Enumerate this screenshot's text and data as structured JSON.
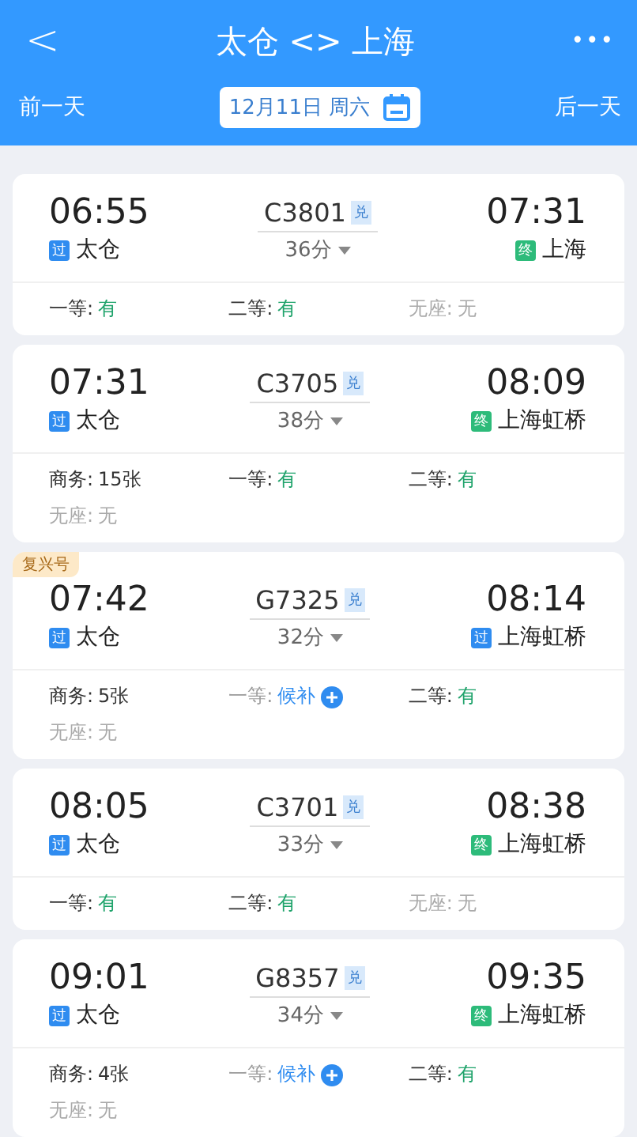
{
  "header": {
    "back": "<",
    "title": "太仓 <> 上海",
    "more": "•••",
    "prev_day": "前一天",
    "date": "12月11日 周六",
    "next_day": "后一天"
  },
  "trains": [
    {
      "depart_time": "06:55",
      "from_tag": {
        "kind": "pass",
        "text": "过"
      },
      "from": "太仓",
      "number": "C3801",
      "exchange": "兑",
      "duration": "36分",
      "arrive_time": "07:31",
      "to_tag": {
        "kind": "end",
        "text": "终"
      },
      "to": "上海",
      "seats": [
        {
          "label": "一等:",
          "value": "有",
          "kind": "avail"
        },
        {
          "label": "二等:",
          "value": "有",
          "kind": "avail"
        },
        {
          "label": "无座:",
          "value": "无",
          "kind": "none"
        }
      ]
    },
    {
      "depart_time": "07:31",
      "from_tag": {
        "kind": "pass",
        "text": "过"
      },
      "from": "太仓",
      "number": "C3705",
      "exchange": "兑",
      "duration": "38分",
      "arrive_time": "08:09",
      "to_tag": {
        "kind": "end",
        "text": "终"
      },
      "to": "上海虹桥",
      "seats": [
        {
          "label": "商务:",
          "value": "15张",
          "kind": "count"
        },
        {
          "label": "一等:",
          "value": "有",
          "kind": "avail"
        },
        {
          "label": "二等:",
          "value": "有",
          "kind": "avail"
        },
        {
          "label": "无座:",
          "value": "无",
          "kind": "none"
        }
      ]
    },
    {
      "badge": "复兴号",
      "depart_time": "07:42",
      "from_tag": {
        "kind": "pass",
        "text": "过"
      },
      "from": "太仓",
      "number": "G7325",
      "exchange": "兑",
      "duration": "32分",
      "arrive_time": "08:14",
      "to_tag": {
        "kind": "pass",
        "text": "过"
      },
      "to": "上海虹桥",
      "seats": [
        {
          "label": "商务:",
          "value": "5张",
          "kind": "count"
        },
        {
          "label": "一等:",
          "value": "候补",
          "kind": "waitlist"
        },
        {
          "label": "二等:",
          "value": "有",
          "kind": "avail"
        },
        {
          "label": "无座:",
          "value": "无",
          "kind": "none"
        }
      ]
    },
    {
      "depart_time": "08:05",
      "from_tag": {
        "kind": "pass",
        "text": "过"
      },
      "from": "太仓",
      "number": "C3701",
      "exchange": "兑",
      "duration": "33分",
      "arrive_time": "08:38",
      "to_tag": {
        "kind": "end",
        "text": "终"
      },
      "to": "上海虹桥",
      "seats": [
        {
          "label": "一等:",
          "value": "有",
          "kind": "avail"
        },
        {
          "label": "二等:",
          "value": "有",
          "kind": "avail"
        },
        {
          "label": "无座:",
          "value": "无",
          "kind": "none"
        }
      ]
    },
    {
      "depart_time": "09:01",
      "from_tag": {
        "kind": "pass",
        "text": "过"
      },
      "from": "太仓",
      "number": "G8357",
      "exchange": "兑",
      "duration": "34分",
      "arrive_time": "09:35",
      "to_tag": {
        "kind": "end",
        "text": "终"
      },
      "to": "上海虹桥",
      "seats": [
        {
          "label": "商务:",
          "value": "4张",
          "kind": "count"
        },
        {
          "label": "一等:",
          "value": "候补",
          "kind": "waitlist"
        },
        {
          "label": "二等:",
          "value": "有",
          "kind": "avail"
        },
        {
          "label": "无座:",
          "value": "无",
          "kind": "none"
        }
      ]
    }
  ]
}
